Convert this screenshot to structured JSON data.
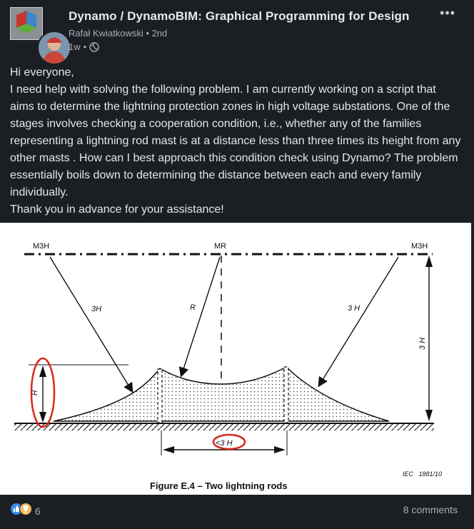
{
  "group": {
    "name": "Dynamo / DynamoBIM: Graphical Programming for Design"
  },
  "author": {
    "name": "Rafał Kwiatkowski",
    "degree": "2nd"
  },
  "meta": {
    "time": "1w"
  },
  "post": {
    "lines": [
      "Hi everyone,",
      "I need help with solving the following problem. I am currently working on a script that aims to determine the lightning protection zones in high voltage substations. One of the stages involves checking a cooperation condition, i.e., whether any of the families representing a lightning rod mast is at a distance less than three times its height from any other masts . How can I best approach this condition check using Dynamo? The problem essentially boils down to determining the distance between each and every family individually.",
      "Thank you in advance for your assistance!"
    ]
  },
  "figure": {
    "label_m3h_left": "M3H",
    "label_mr": "MR",
    "label_m3h_right": "M3H",
    "label_3h_left": "3H",
    "label_r": "R",
    "label_3h_right": "3 H",
    "label_3h_vertical": "3 H",
    "label_h": "H",
    "label_lt3h": "<3 H",
    "code": "IEC   1881/10",
    "caption": "Figure E.4 – Two lightning rods"
  },
  "footer": {
    "reaction_count": "6",
    "comments": "8 comments"
  },
  "icons": [
    "group-logo",
    "avatar",
    "globe-icon",
    "more-icon",
    "like-icon",
    "insightful-icon"
  ],
  "colors": {
    "background": "#1b1f23",
    "annotation_red": "#d42a1c"
  }
}
